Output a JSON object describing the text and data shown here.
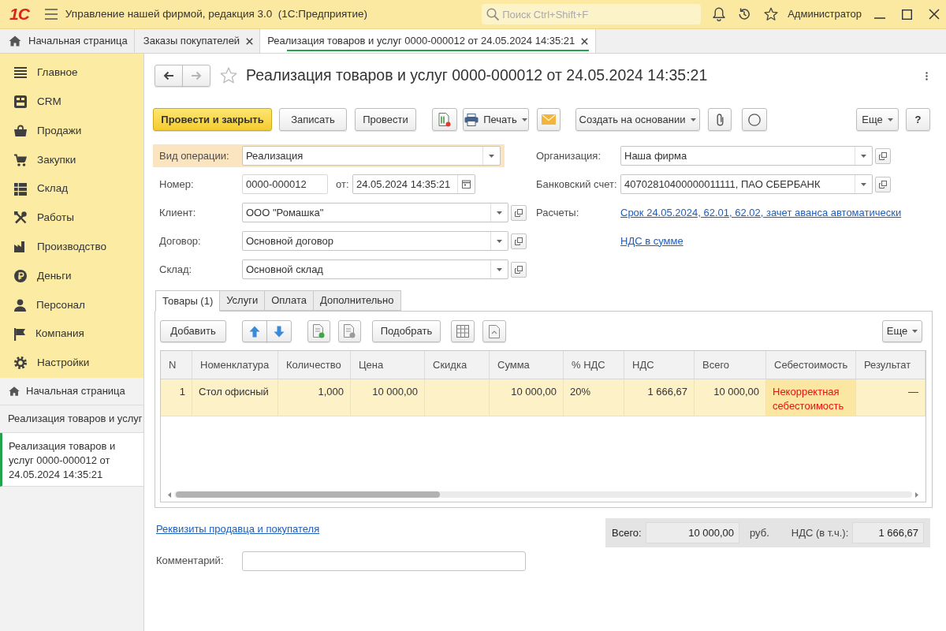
{
  "app": {
    "logo": "1С",
    "title": "Управление нашей фирмой, редакция 3.0  (1С:Предприятие)",
    "search": {
      "placeholder": "Поиск Ctrl+Shift+F"
    },
    "user": "Администратор"
  },
  "open_tabs": [
    {
      "kind": "home",
      "label": "Начальная страница",
      "selected": false,
      "closable": false
    },
    {
      "kind": "document",
      "label": "Заказы покупателей",
      "selected": false,
      "closable": true
    },
    {
      "kind": "document",
      "label": "Реализация товаров и услуг 0000-000012 от 24.05.2024 14:35:21",
      "selected": true,
      "closable": true
    }
  ],
  "sidebar": {
    "sections": [
      {
        "label": "Главное"
      },
      {
        "label": "CRM"
      },
      {
        "label": "Продажи"
      },
      {
        "label": "Закупки"
      },
      {
        "label": "Склад"
      },
      {
        "label": "Работы"
      },
      {
        "label": "Производство"
      },
      {
        "label": "Деньги"
      },
      {
        "label": "Персонал"
      },
      {
        "label": "Компания"
      },
      {
        "label": "Настройки"
      }
    ],
    "history": [
      {
        "kind": "home",
        "label": "Начальная страница",
        "selected": false
      },
      {
        "kind": "document",
        "label": "Реализация товаров и услуг",
        "selected": false
      },
      {
        "kind": "document",
        "label": "Реализация товаров и услуг 0000-000012 от 24.05.2024 14:35:21",
        "selected": true
      }
    ]
  },
  "form": {
    "title": "Реализация товаров и услуг 0000-000012 от 24.05.2024 14:35:21",
    "favorite": false,
    "back_disabled": false,
    "forward_disabled": true,
    "toolbar": {
      "post_and_close": "Провести и закрыть",
      "save": "Записать",
      "post": "Провести",
      "print": "Печать",
      "create_based_on": "Создать на основании",
      "more": "Еще",
      "help": "?"
    },
    "fields_left": [
      {
        "kind": "select",
        "label": "Вид операции:",
        "value": "Реализация",
        "highlighted": true
      },
      {
        "kind": "number",
        "label": "Номер:",
        "value": "0000-000012",
        "date_label": "от:",
        "date": "24.05.2024 14:35:21",
        "highlighted": false
      },
      {
        "kind": "reference",
        "label": "Клиент:",
        "value": "ООО \"Ромашка\"",
        "highlighted": false
      },
      {
        "kind": "reference",
        "label": "Договор:",
        "value": "Основной договор",
        "highlighted": false
      },
      {
        "kind": "reference",
        "label": "Склад:",
        "value": "Основной склад",
        "highlighted": false
      }
    ],
    "fields_right": [
      {
        "kind": "reference",
        "label": "Организация:",
        "value": "Наша фирма"
      },
      {
        "kind": "reference",
        "label": "Банковский счет:",
        "value": "40702810400000011111, ПАО СБЕРБАНК"
      },
      {
        "kind": "link",
        "label": "Расчеты:",
        "value": "Срок 24.05.2024, 62.01, 62.02, зачет аванса автоматически"
      },
      {
        "kind": "link",
        "value": "НДС в сумме"
      }
    ],
    "tabs": [
      {
        "label": "Товары (1)",
        "selected": true
      },
      {
        "label": "Услуги",
        "selected": false
      },
      {
        "label": "Оплата",
        "selected": false
      },
      {
        "label": "Дополнительно",
        "selected": false
      }
    ],
    "table_toolbar": {
      "add": "Добавить",
      "pick": "Подобрать",
      "more": "Еще"
    },
    "table": {
      "columns": [
        "N",
        "Номенклатура",
        "Количество",
        "Цена",
        "Скидка",
        "Сумма",
        "% НДС",
        "НДС",
        "Всего",
        "Себестоимость",
        "Результат"
      ],
      "rows": [
        {
          "selected": true,
          "cost_invalid": true,
          "cells": [
            "1",
            "Стол офисный",
            "1,000",
            "10 000,00",
            null,
            "10 000,00",
            "20%",
            "1 666,67",
            "10 000,00",
            "Некорректная себестоимость",
            "—"
          ]
        }
      ]
    },
    "details_link": "Реквизиты продавца и покупателя",
    "comment": {
      "label": "Комментарий:"
    },
    "totals": {
      "total_label": "Всего:",
      "total": "10 000,00",
      "currency": "руб.",
      "vat_label": "НДС (в т.ч.):",
      "vat": "1 666,67"
    }
  }
}
